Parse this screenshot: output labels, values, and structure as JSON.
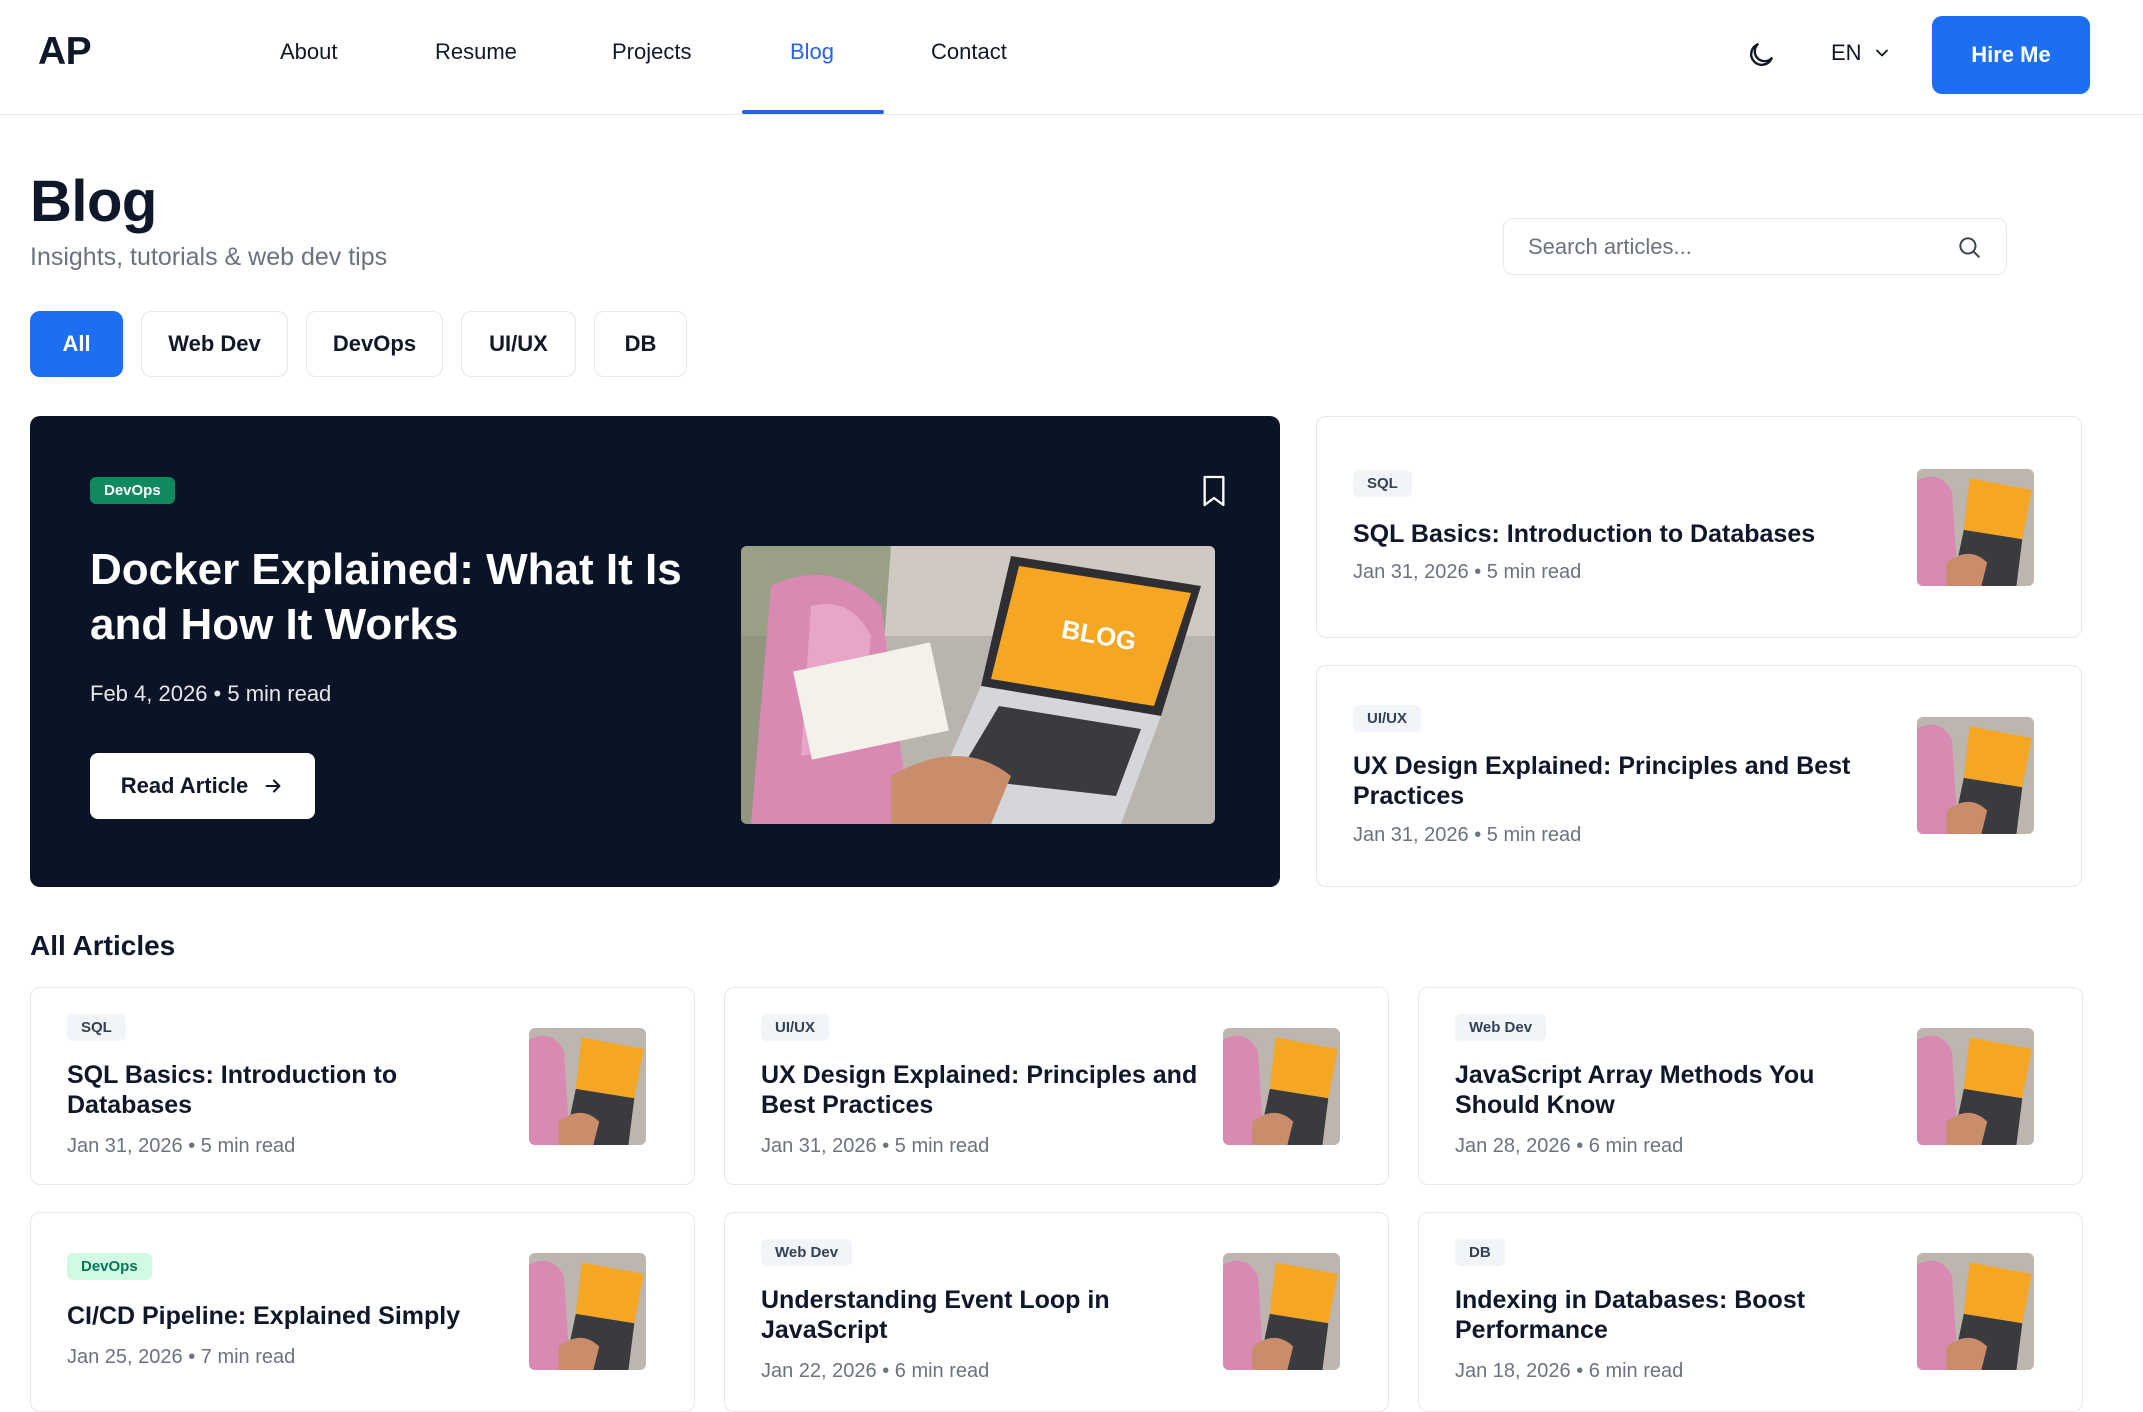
{
  "header": {
    "logo": "AP",
    "nav": [
      "About",
      "Resume",
      "Projects",
      "Blog",
      "Contact"
    ],
    "active_nav": "Blog",
    "language": "EN",
    "hire_label": "Hire Me",
    "accent": "#1d6ff2"
  },
  "page": {
    "title": "Blog",
    "subtitle": "Insights, tutorials & web dev tips",
    "search_placeholder": "Search articles...",
    "filters": [
      "All",
      "Web Dev",
      "DevOps",
      "UI/UX",
      "DB"
    ],
    "active_filter": "All"
  },
  "featured": {
    "tag": "DevOps",
    "title": "Docker Explained: What It Is and How It Works",
    "meta": "Feb 4, 2026 • 5 min read",
    "button": "Read Article",
    "image_text": "BLOG"
  },
  "side_articles": [
    {
      "tag": "SQL",
      "title": "SQL Basics: Introduction to Databases",
      "meta": "Jan 31, 2026 • 5 min read"
    },
    {
      "tag": "UI/UX",
      "title": "UX Design Explained: Principles and Best Practices",
      "meta": "Jan 31, 2026 • 5 min read"
    }
  ],
  "all_articles_title": "All Articles",
  "articles": [
    {
      "tag": "SQL",
      "title": "SQL Basics: Introduction to Databases",
      "meta": "Jan 31, 2026 • 5 min read"
    },
    {
      "tag": "UI/UX",
      "title": "UX Design Explained: Principles and Best Practices",
      "meta": "Jan 31, 2026 • 5 min read"
    },
    {
      "tag": "Web Dev",
      "title": "JavaScript Array Methods You Should Know",
      "meta": "Jan 28, 2026 • 6 min read"
    },
    {
      "tag": "DevOps",
      "title": "CI/CD Pipeline: Explained Simply",
      "meta": "Jan 25, 2026 • 7 min read"
    },
    {
      "tag": "Web Dev",
      "title": "Understanding Event Loop in JavaScript",
      "meta": "Jan 22, 2026 • 6 min read"
    },
    {
      "tag": "DB",
      "title": "Indexing in Databases: Boost Performance",
      "meta": "Jan 18, 2026 • 6 min read"
    }
  ]
}
